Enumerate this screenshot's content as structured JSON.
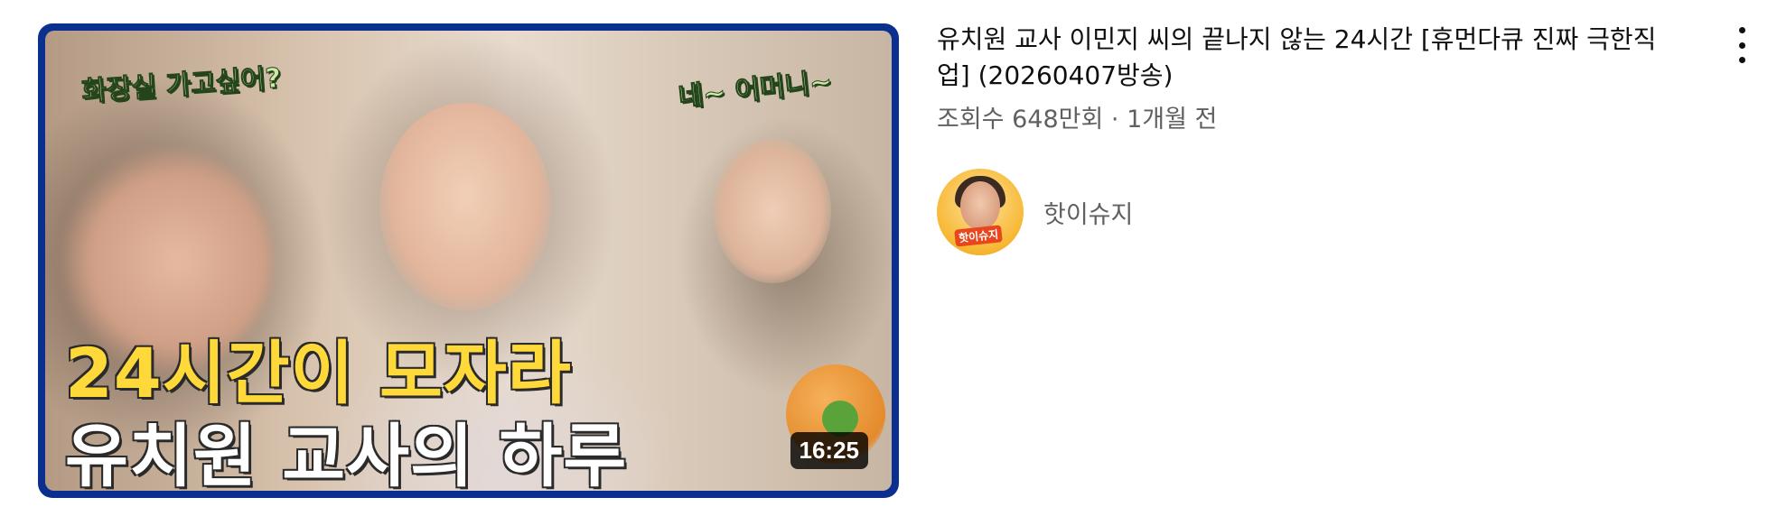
{
  "video": {
    "title": "유치원 교사 이민지 씨의 끝나지 않는 24시간 [휴먼다큐 진짜 극한직업] (20260407방송)",
    "views": "조회수 648만회",
    "separator": " · ",
    "age": "1개월 전",
    "duration": "16:25"
  },
  "thumbnail": {
    "bubble_left": "화장실 가고싶어?",
    "bubble_right": "네~ 어머니~",
    "headline_line1": "24시간이 모자라",
    "headline_line2": "유치원 교사의 하루",
    "frame_color": "#0a2f8f",
    "headline1_color": "#ffd93a"
  },
  "channel": {
    "name": "핫이슈지",
    "avatar_badge": "핫이슈지"
  },
  "icons": {
    "menu": "more-vert-icon"
  }
}
